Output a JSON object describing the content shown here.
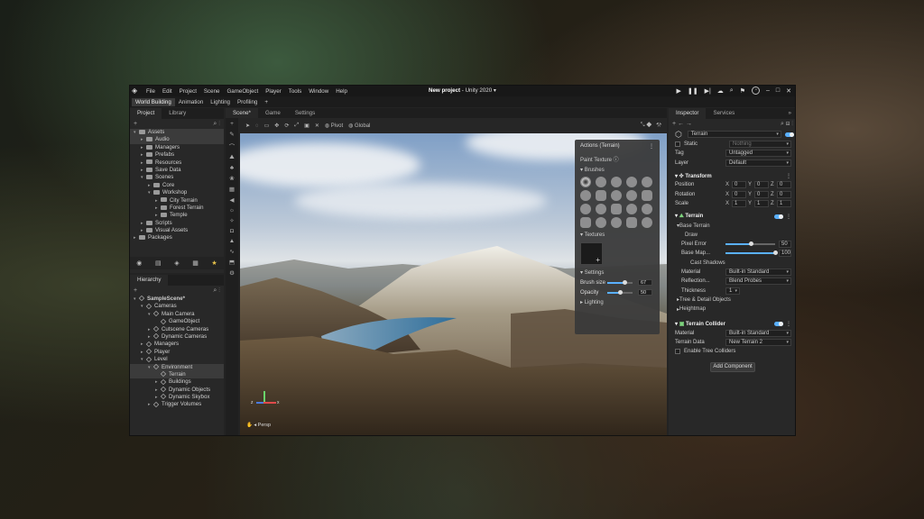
{
  "window": {
    "title_bold": "New project",
    "title_rest": " - Unity 2020 ▾"
  },
  "menu": [
    "File",
    "Edit",
    "Project",
    "Scene",
    "GameObject",
    "Player",
    "Tools",
    "Window",
    "Help"
  ],
  "layout_tabs": [
    "World Building",
    "Animation",
    "Lighting",
    "Profiling",
    "+"
  ],
  "project": {
    "tabs": [
      "Project",
      "Library"
    ],
    "tree": [
      {
        "l": "Assets",
        "d": 0,
        "a": "▾",
        "sel": true
      },
      {
        "l": "Audio",
        "d": 1,
        "a": "▸",
        "sel": true
      },
      {
        "l": "Managers",
        "d": 1,
        "a": "▸"
      },
      {
        "l": "Prefabs",
        "d": 1,
        "a": "▸"
      },
      {
        "l": "Resources",
        "d": 1,
        "a": "▸"
      },
      {
        "l": "Save Data",
        "d": 1,
        "a": "▸"
      },
      {
        "l": "Scenes",
        "d": 1,
        "a": "▾"
      },
      {
        "l": "Core",
        "d": 2,
        "a": "▸"
      },
      {
        "l": "Workshop",
        "d": 2,
        "a": "▾"
      },
      {
        "l": "City Terrain",
        "d": 3,
        "a": "▸"
      },
      {
        "l": "Forest Terrain",
        "d": 3,
        "a": "▸"
      },
      {
        "l": "Temple",
        "d": 3,
        "a": "▸"
      },
      {
        "l": "Scripts",
        "d": 1,
        "a": "▸"
      },
      {
        "l": "Visual Assets",
        "d": 1,
        "a": "▸"
      },
      {
        "l": "Packages",
        "d": 0,
        "a": "▸"
      }
    ]
  },
  "hierarchy": {
    "tabs": [
      "Hierarchy"
    ],
    "tree": [
      {
        "l": "SampleScene*",
        "d": 0,
        "a": "▾",
        "b": true
      },
      {
        "l": "Cameras",
        "d": 1,
        "a": "▾"
      },
      {
        "l": "Main Camera",
        "d": 2,
        "a": "▾"
      },
      {
        "l": "GameObject",
        "d": 3,
        "a": ""
      },
      {
        "l": "Cutscene Cameras",
        "d": 2,
        "a": "▸"
      },
      {
        "l": "Dynamic Cameras",
        "d": 2,
        "a": "▸"
      },
      {
        "l": "Managers",
        "d": 1,
        "a": "▸"
      },
      {
        "l": "Player",
        "d": 1,
        "a": "▸"
      },
      {
        "l": "Level",
        "d": 1,
        "a": "▾"
      },
      {
        "l": "Environment",
        "d": 2,
        "a": "▾",
        "sel": true
      },
      {
        "l": "Terrain",
        "d": 3,
        "a": "",
        "sel": true
      },
      {
        "l": "Buildings",
        "d": 3,
        "a": "▸"
      },
      {
        "l": "Dynamic Objects",
        "d": 3,
        "a": "▸"
      },
      {
        "l": "Dynamic Skybox",
        "d": 3,
        "a": "▸"
      },
      {
        "l": "Trigger Volumes",
        "d": 2,
        "a": "▸"
      }
    ]
  },
  "scene": {
    "tabs": [
      "Scene*",
      "Game",
      "Settings"
    ],
    "pivot": "Pivot",
    "global": "Global",
    "persp": "Persp"
  },
  "overlay": {
    "title": "Actions (Terrain)",
    "paint": "Paint Texture",
    "brushes": "Brushes",
    "textures": "Textures",
    "settings": "Settings",
    "brush_size_label": "Brush size",
    "brush_size": "67",
    "opacity_label": "Opacity",
    "opacity": "50",
    "lighting": "Lighting",
    "brush_size_frac": 0.67,
    "opacity_frac": 0.5
  },
  "inspector": {
    "tabs": [
      "Inspector",
      "Services"
    ],
    "name": "Terrain",
    "static_label": "Static",
    "static_val": "Nothing",
    "tag_label": "Tag",
    "tag": "Untagged",
    "layer_label": "Layer",
    "layer": "Default",
    "transform": "Transform",
    "position": "Position",
    "rotation": "Rotation",
    "scale": "Scale",
    "pos": [
      "0",
      "0",
      "0"
    ],
    "rot": [
      "0",
      "0",
      "0"
    ],
    "scl": [
      "1",
      "1",
      "1"
    ],
    "terrain": "Terrain",
    "base_terrain": "Base Terrain",
    "draw": "Draw",
    "pixel_error": "Pixel Error",
    "pixel_error_val": "50",
    "base_map": "Base Map...",
    "base_map_val": "100",
    "cast_shadows": "Cast Shadows",
    "material": "Material",
    "material_val": "Built-in Standard",
    "reflection": "Reflection...",
    "reflection_val": "Blend Probes",
    "thickness": "Thickness",
    "thickness_val": "1",
    "tree_detail": "Tree & Detail Objects",
    "heightmap": "Heightmap",
    "collider": "Terrain Collider",
    "c_material": "Material",
    "c_material_val": "Built-in Standard",
    "terrain_data": "Terrain Data",
    "terrain_data_val": "New Terrain 2",
    "enable_tree": "Enable Tree Colliders",
    "add": "Add Component"
  }
}
